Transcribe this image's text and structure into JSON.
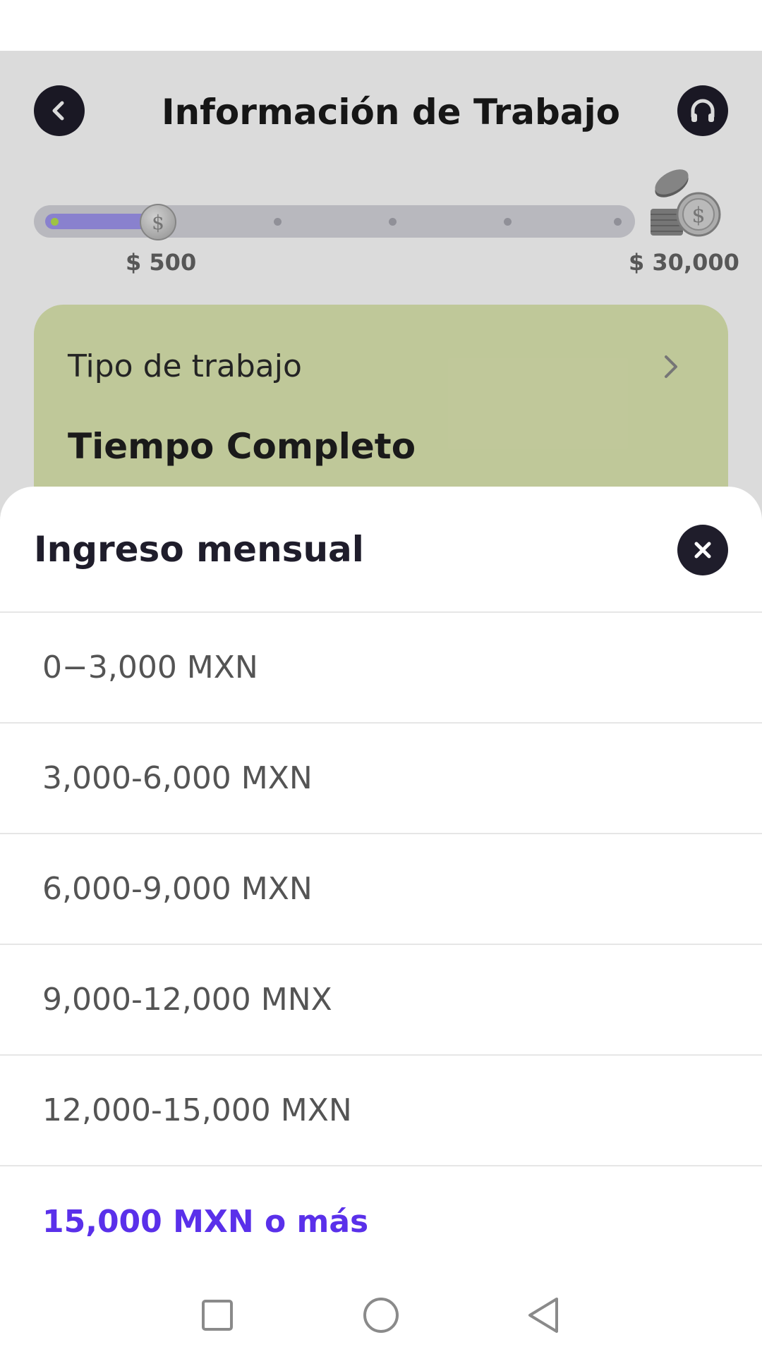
{
  "header": {
    "title": "Información de Trabajo",
    "back_icon": "chevron-left-icon",
    "support_icon": "headset-icon"
  },
  "progress": {
    "min_label": "$ 500",
    "max_label": "$ 30,000",
    "value_fraction": 0.19,
    "steps": 5,
    "fill_color": "#a097f0",
    "track_color": "#d7d7de"
  },
  "job_card": {
    "label": "Tipo de trabajo",
    "value": "Tiempo Completo",
    "background": "#dfe9b3"
  },
  "sheet": {
    "title": "Ingreso mensual",
    "close_icon": "close-icon",
    "options": [
      {
        "label": "0−3,000 MXN",
        "selected": false
      },
      {
        "label": "3,000-6,000 MXN",
        "selected": false
      },
      {
        "label": "6,000-9,000 MXN",
        "selected": false
      },
      {
        "label": "9,000-12,000 MNX",
        "selected": false
      },
      {
        "label": "12,000-15,000 MXN",
        "selected": false
      },
      {
        "label": "15,000 MXN o más",
        "selected": true
      }
    ],
    "selected_color": "#5a30ea"
  },
  "nav": {
    "recent_icon": "square-icon",
    "home_icon": "circle-icon",
    "back_icon": "triangle-back-icon"
  }
}
